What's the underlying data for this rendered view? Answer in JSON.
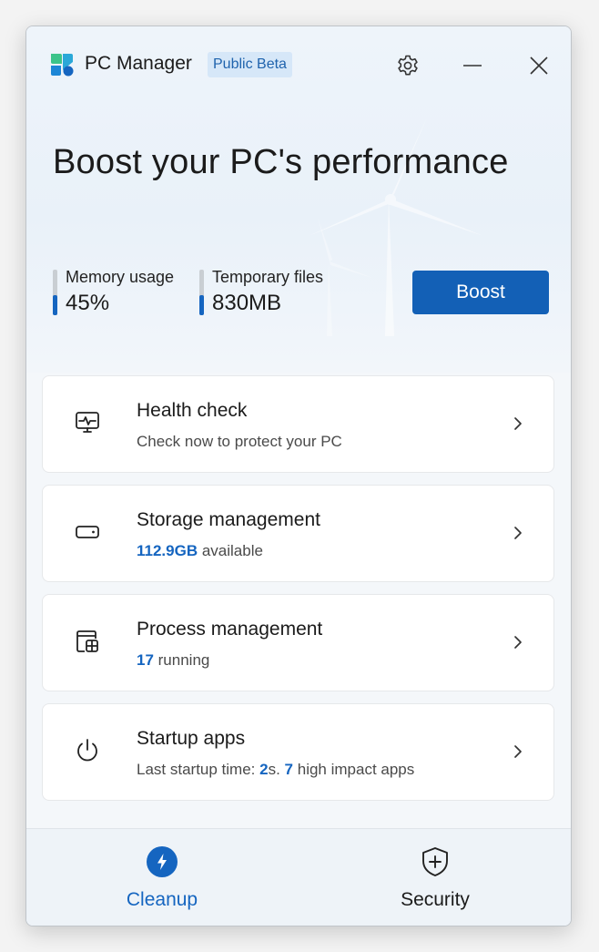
{
  "app": {
    "title": "PC Manager",
    "badge": "Public Beta"
  },
  "hero": {
    "headline": "Boost your PC's performance",
    "metrics": [
      {
        "label": "Memory usage",
        "value": "45%",
        "level": 0.45
      },
      {
        "label": "Temporary files",
        "value": "830MB",
        "level": 0.45
      }
    ],
    "boost_label": "Boost"
  },
  "cards": [
    {
      "title": "Health check",
      "subtitle": "Check now to protect your PC",
      "icon": "health-monitor-icon"
    },
    {
      "title": "Storage management",
      "highlight": "112.9GB",
      "subtitle_rest": " available",
      "icon": "drive-icon"
    },
    {
      "title": "Process management",
      "highlight": "17",
      "subtitle_rest": " running",
      "icon": "process-window-icon"
    },
    {
      "title": "Startup apps",
      "sub_a": "Last startup time: ",
      "sub_b": "2",
      "sub_c": "s. ",
      "sub_d": "7",
      "sub_e": " high impact apps",
      "icon": "power-icon"
    }
  ],
  "nav": {
    "cleanup": "Cleanup",
    "security": "Security",
    "active": "cleanup"
  },
  "colors": {
    "accent": "#1565c0",
    "button": "#1360b6",
    "badge_bg": "#d6e7f8"
  }
}
